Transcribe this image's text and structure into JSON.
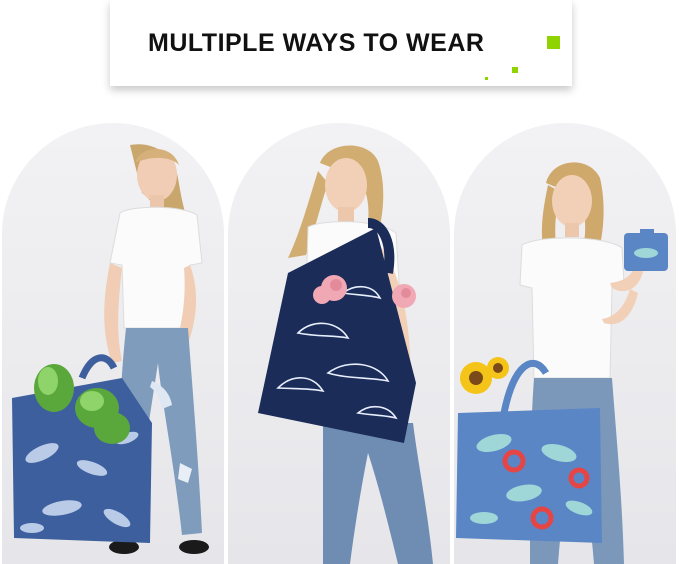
{
  "banner": {
    "title": "MULTIPLE WAYS TO WEAR",
    "accent_color": "#8fd400"
  },
  "models": [
    {
      "pose": "hand-carry",
      "bag_color": "#3d5f9e",
      "bag_pattern": "whales",
      "produce": "leafy greens"
    },
    {
      "pose": "shoulder-carry",
      "bag_color": "#1b2c58",
      "bag_pattern": "dolphins",
      "produce": "pink flowers"
    },
    {
      "pose": "folded-pouch",
      "bag_color": "#5a86c6",
      "bag_pattern": "dolphins with life rings",
      "produce": "sunflower"
    }
  ]
}
